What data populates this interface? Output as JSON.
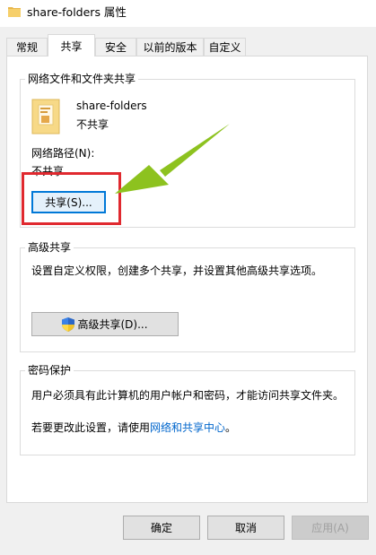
{
  "window": {
    "title": "share-folders 属性"
  },
  "tabs": [
    {
      "label": "常规"
    },
    {
      "label": "共享"
    },
    {
      "label": "安全"
    },
    {
      "label": "以前的版本"
    },
    {
      "label": "自定义"
    }
  ],
  "network_sharing": {
    "group_title": "网络文件和文件夹共享",
    "folder_name": "share-folders",
    "folder_status": "不共享",
    "path_label": "网络路径(N):",
    "path_value": "不共享",
    "share_button": "共享(S)..."
  },
  "advanced_sharing": {
    "group_title": "高级共享",
    "description": "设置自定义权限，创建多个共享，并设置其他高级共享选项。",
    "button": "高级共享(D)..."
  },
  "password_protection": {
    "group_title": "密码保护",
    "description": "用户必须具有此计算机的用户帐户和密码，才能访问共享文件夹。",
    "change_prefix": "若要更改此设置，请使用",
    "change_link": "网络和共享中心",
    "change_suffix": "。"
  },
  "footer": {
    "ok": "确定",
    "cancel": "取消",
    "apply": "应用(A)"
  },
  "colors": {
    "annotation_box": "#e0292f",
    "annotation_arrow": "#8dc21f",
    "link": "#0066cc"
  }
}
